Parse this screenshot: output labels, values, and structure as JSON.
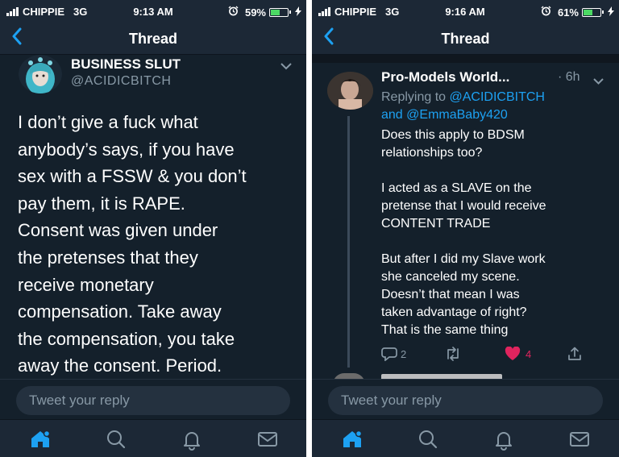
{
  "left": {
    "status": {
      "carrier": "CHIPPIE",
      "network": "3G",
      "time": "9:13 AM",
      "battery": "59%",
      "battery_level": 0.59
    },
    "nav": {
      "back_icon": "chevron-left-icon",
      "title": "Thread"
    },
    "tweet": {
      "display_name": "BUSINESS SLUT",
      "handle": "@ACIDICBITCH",
      "lines": [
        "I don’t give a fuck what",
        "anybody’s says, if you have",
        "sex with a FSSW & you don’t",
        "pay them, it is RAPE.",
        "Consent was given under",
        "the pretenses that they",
        "receive monetary",
        "compensation. Take away",
        "the compensation, you take",
        "away the consent. Period."
      ]
    },
    "reply_placeholder": "Tweet your reply",
    "tabs": [
      "home-icon",
      "search-icon",
      "notifications-icon",
      "messages-icon"
    ]
  },
  "right": {
    "status": {
      "carrier": "CHIPPIE",
      "network": "3G",
      "time": "9:16 AM",
      "battery": "61%",
      "battery_level": 0.61
    },
    "nav": {
      "back_icon": "chevron-left-icon",
      "title": "Thread"
    },
    "tweet": {
      "display_name": "Pro-Models World...",
      "time": "· 6h",
      "replying_prefix": "Replying to",
      "replying_handle1": "@ACIDICBITCH",
      "replying_and": "and",
      "replying_handle2": "@EmmaBaby420",
      "lines": [
        "Does this apply to BDSM",
        "relationships too?",
        "",
        "I acted as a SLAVE on the",
        "pretense that I would receive",
        "CONTENT TRADE",
        "",
        "But after I did my Slave work",
        "she canceled my scene.",
        "Doesn’t that mean I was",
        "taken advantage of right?",
        "That is the same thing"
      ],
      "reply_count": "2",
      "like_count": "4"
    },
    "reply_placeholder": "Tweet your reply",
    "tabs": [
      "home-icon",
      "search-icon",
      "notifications-icon",
      "messages-icon"
    ]
  },
  "colors": {
    "background": "#14202b",
    "bar": "#1c2836",
    "accent": "#1da1f2",
    "like": "#e0245e",
    "muted": "#8899a6"
  }
}
